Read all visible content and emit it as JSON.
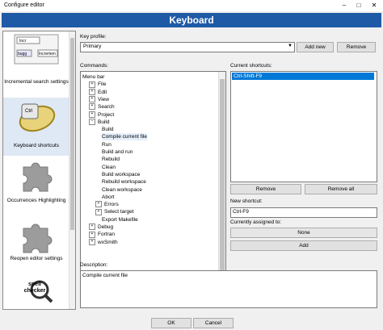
{
  "window": {
    "title": "Configure editor",
    "controls": {
      "minimize": "–",
      "maximize": "□",
      "close": "✕"
    }
  },
  "header": {
    "title": "Keyboard"
  },
  "sidebar": {
    "items": [
      {
        "label": "Incremental search settings",
        "icon": "incremental-search-icon"
      },
      {
        "label": "Keyboard shortcuts",
        "icon": "keyboard-shortcuts-icon",
        "selected": true
      },
      {
        "label": "Occurrences Highlighting",
        "icon": "puzzle-icon"
      },
      {
        "label": "Reopen editor settings",
        "icon": "puzzle-icon"
      },
      {
        "label": "",
        "icon": "spell-checker-icon"
      }
    ],
    "thumb_text": {
      "a": "Incr",
      "b": "bugg",
      "c": "Incremen"
    },
    "ctrl_text": "Ctrl",
    "spell_text": "spell checker"
  },
  "key_profile": {
    "label": "Key profile:",
    "value": "Primary",
    "add_new": "Add new",
    "remove": "Remove"
  },
  "commands": {
    "label": "Commands:",
    "tree": [
      {
        "label": "Menu bar",
        "level": 0,
        "expander": ""
      },
      {
        "label": "File",
        "level": 1,
        "expander": "+"
      },
      {
        "label": "Edit",
        "level": 1,
        "expander": "+"
      },
      {
        "label": "View",
        "level": 1,
        "expander": "+"
      },
      {
        "label": "Search",
        "level": 1,
        "expander": "+"
      },
      {
        "label": "Project",
        "level": 1,
        "expander": "+"
      },
      {
        "label": "Build",
        "level": 1,
        "expander": "−"
      },
      {
        "label": "Build",
        "level": 2,
        "expander": ""
      },
      {
        "label": "Compile current file",
        "level": 2,
        "expander": "",
        "highlight": true
      },
      {
        "label": "Run",
        "level": 2,
        "expander": ""
      },
      {
        "label": "Build and run",
        "level": 2,
        "expander": ""
      },
      {
        "label": "Rebuild",
        "level": 2,
        "expander": ""
      },
      {
        "label": "Clean",
        "level": 2,
        "expander": ""
      },
      {
        "label": "Build workspace",
        "level": 2,
        "expander": ""
      },
      {
        "label": "Rebuild workspace",
        "level": 2,
        "expander": ""
      },
      {
        "label": "Clean workspace",
        "level": 2,
        "expander": ""
      },
      {
        "label": "Abort",
        "level": 2,
        "expander": ""
      },
      {
        "label": "Errors",
        "level": 2,
        "expander": "+"
      },
      {
        "label": "Select target",
        "level": 2,
        "expander": "+"
      },
      {
        "label": "Export Makefile",
        "level": 2,
        "expander": ""
      },
      {
        "label": "Debug",
        "level": 1,
        "expander": "+"
      },
      {
        "label": "Fortran",
        "level": 1,
        "expander": "+"
      },
      {
        "label": "wxSmith",
        "level": 1,
        "expander": "+"
      }
    ]
  },
  "current_shortcuts": {
    "label": "Current shortcuts:",
    "items": [
      "Ctrl-Shift-F9"
    ],
    "remove": "Remove",
    "remove_all": "Remove all"
  },
  "new_shortcut": {
    "label": "New shortcut:",
    "value": "Ctrl-F9"
  },
  "currently_assigned": {
    "label": "Currently assigned to:",
    "value": "None"
  },
  "add_button": "Add",
  "description": {
    "label": "Description:",
    "value": "Compile current file"
  },
  "footer": {
    "ok": "OK",
    "cancel": "Cancel"
  }
}
